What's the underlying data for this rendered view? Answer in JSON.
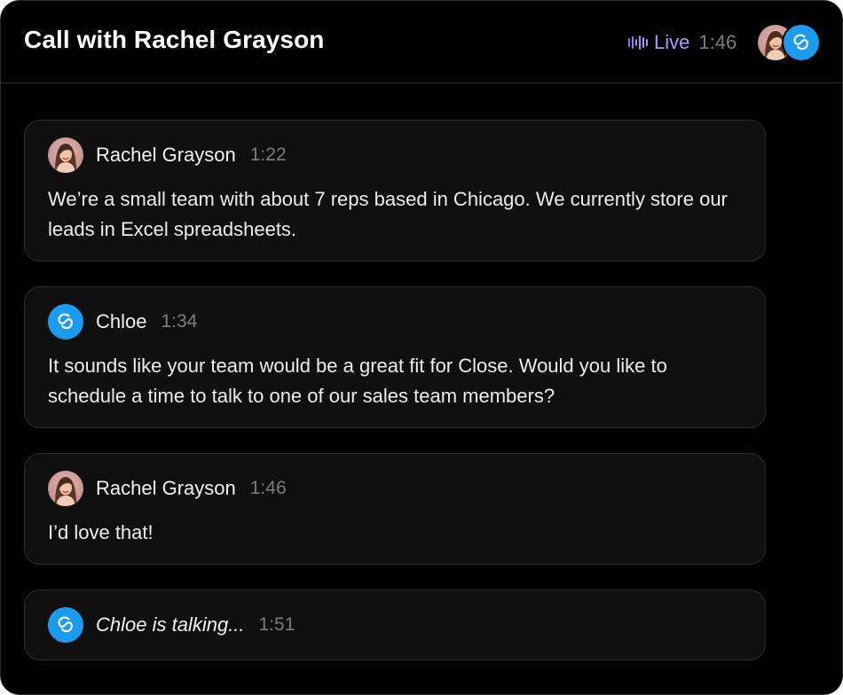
{
  "header": {
    "title": "Call with Rachel Grayson",
    "status_label": "Live",
    "elapsed": "1:46",
    "status_icon": "audio-wave-icon",
    "live_color": "#b495ff"
  },
  "participants": {
    "caller": {
      "name": "Rachel Grayson",
      "avatar": "avatar-photo"
    },
    "agent": {
      "name": "Chloe",
      "avatar": "close-logo-icon",
      "color": "#1a9bf0"
    }
  },
  "transcript": [
    {
      "speaker": "Rachel Grayson",
      "time": "1:22",
      "text": "We’re a small team with about 7 reps based in Chicago. We currently store our leads in Excel spreadsheets."
    },
    {
      "speaker": "Chloe",
      "time": "1:34",
      "text": "It sounds like your team would be a great fit for Close. Would you like to schedule a time to talk to one of our sales team members?"
    },
    {
      "speaker": "Rachel Grayson",
      "time": "1:46",
      "text": "I’d love that!"
    }
  ],
  "typing": {
    "label": "Chloe is talking...",
    "time": "1:51"
  }
}
